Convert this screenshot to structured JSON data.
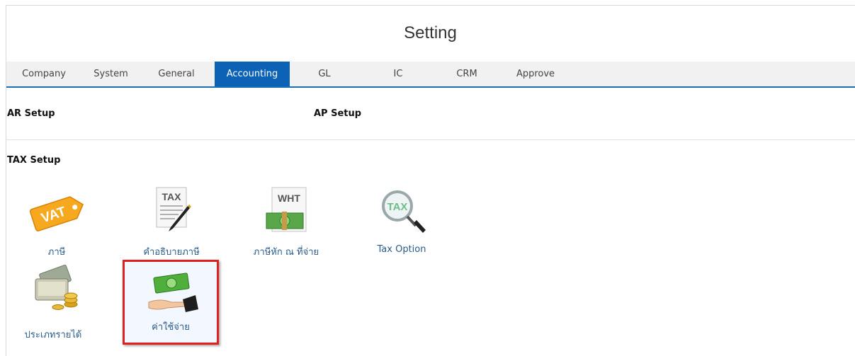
{
  "page": {
    "title": "Setting"
  },
  "tabs": [
    {
      "label": "Company"
    },
    {
      "label": "System"
    },
    {
      "label": "General"
    },
    {
      "label": "Accounting",
      "active": true
    },
    {
      "label": "GL"
    },
    {
      "label": "IC"
    },
    {
      "label": "CRM"
    },
    {
      "label": "Approve"
    }
  ],
  "sections": {
    "ar": "AR Setup",
    "ap": "AP Setup",
    "tax": "TAX Setup"
  },
  "tax_items": [
    {
      "label": "ภาษี",
      "icon": "vat-tag-icon",
      "icon_text": "VAT"
    },
    {
      "label": "คำอธิบายภาษี",
      "icon": "tax-document-pen-icon",
      "icon_text": "TAX"
    },
    {
      "label": "ภาษีหัก ณ ที่จ่าย",
      "icon": "wht-money-icon",
      "icon_text": "WHT"
    },
    {
      "label": "Tax Option",
      "icon": "tax-magnifier-icon",
      "icon_text": "TAX"
    },
    {
      "label": "ประเภทรายได้",
      "icon": "money-coins-icon"
    },
    {
      "label": "ค่าใช้จ่าย",
      "icon": "hand-money-icon",
      "highlighted": true
    }
  ],
  "colors": {
    "tab_active": "#0c62b4",
    "highlight_border": "#e02020",
    "link_text": "#2a5b8a"
  }
}
